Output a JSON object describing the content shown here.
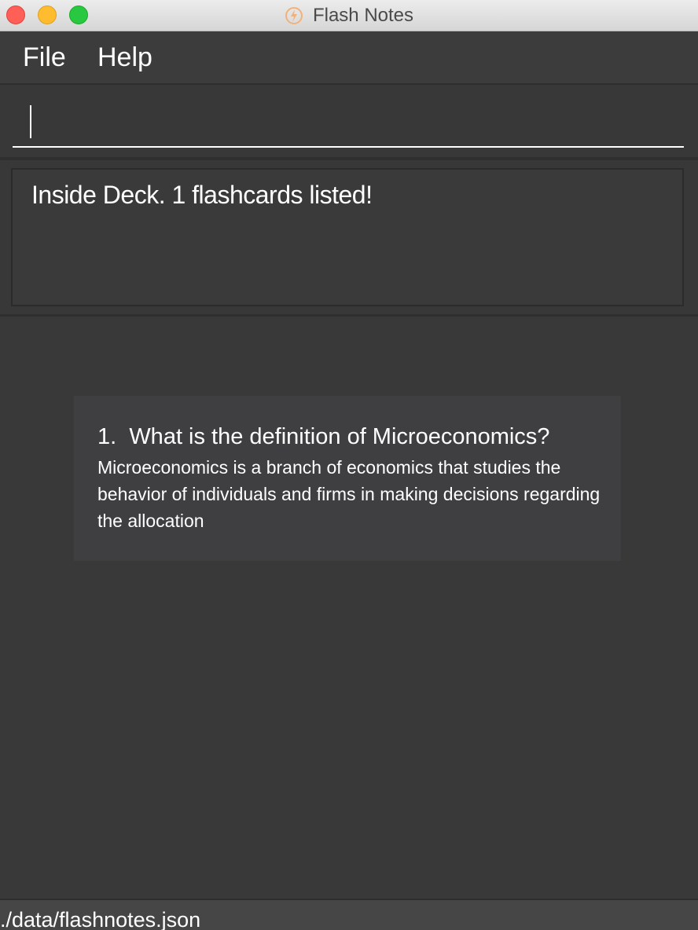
{
  "window": {
    "title": "Flash Notes",
    "icon": "lightning-bolt-icon"
  },
  "menubar": {
    "items": [
      {
        "label": "File"
      },
      {
        "label": "Help"
      }
    ]
  },
  "command_box": {
    "value": ""
  },
  "result_display": {
    "text": "Inside Deck. 1 flashcards listed!"
  },
  "flashcards": [
    {
      "index": "1.",
      "question": "What is the definition of Microeconomics?",
      "answer": "Microeconomics is a branch of economics that studies the behavior of individuals and firms in making decisions regarding the allocation"
    }
  ],
  "status_bar": {
    "file_path": "./data/flashnotes.json"
  },
  "colors": {
    "background": "#393939",
    "card_background": "#3f3f41",
    "text": "#ffffff"
  }
}
